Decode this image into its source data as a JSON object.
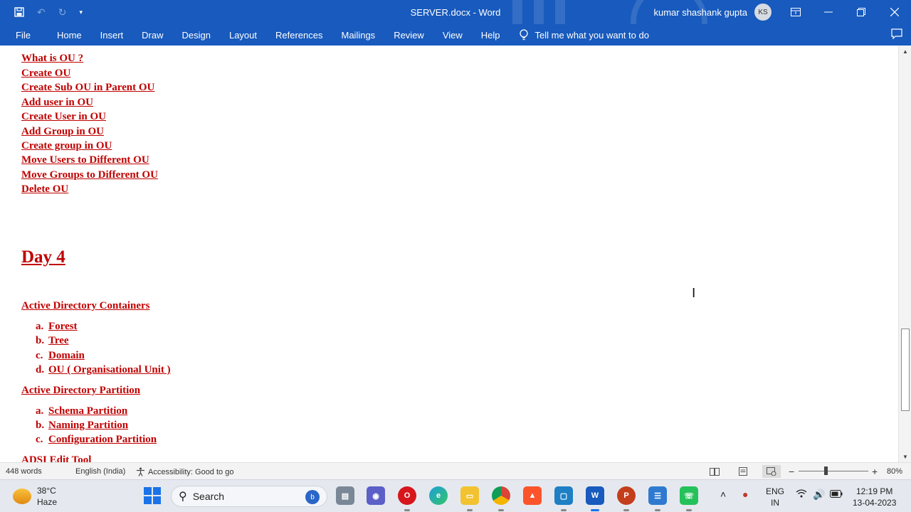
{
  "window": {
    "title": "SERVER.docx",
    "app_name": "Word",
    "user_name": "kumar shashank gupta",
    "user_initials": "KS"
  },
  "ribbon": {
    "tabs": [
      "File",
      "Home",
      "Insert",
      "Draw",
      "Design",
      "Layout",
      "References",
      "Mailings",
      "Review",
      "View",
      "Help"
    ],
    "tell_me": "Tell me what you want to do"
  },
  "document": {
    "ou_links": [
      "What is OU ?",
      "Create OU",
      "Create Sub OU in Parent OU",
      "Add user in OU",
      "Create User in OU",
      "Add Group in OU",
      "Create group in OU",
      "Move Users to Different OU",
      "Move Groups to Different OU",
      "Delete OU"
    ],
    "day_heading": "Day 4",
    "containers": {
      "heading": "Active Directory Containers",
      "items": [
        {
          "marker": "a.",
          "label": "Forest"
        },
        {
          "marker": "b.",
          "label": "Tree"
        },
        {
          "marker": "c.",
          "label": "Domain"
        },
        {
          "marker": "d.",
          "label": "OU ( Organisational Unit )"
        }
      ]
    },
    "partition": {
      "heading": "Active Directory Partition",
      "items": [
        {
          "marker": "a.",
          "label": "Schema Partition"
        },
        {
          "marker": "b.",
          "label": "Naming Partition"
        },
        {
          "marker": "c.",
          "label": "Configuration Partition"
        }
      ]
    },
    "cut_off_heading": "ADSI Edit Tool"
  },
  "status_bar": {
    "word_count": "448 words",
    "language": "English (India)",
    "accessibility": "Accessibility: Good to go",
    "zoom": "80%"
  },
  "taskbar": {
    "temperature": "38°C",
    "weather": "Haze",
    "search_label": "Search",
    "lang_primary": "ENG",
    "lang_secondary": "IN",
    "time": "12:19 PM",
    "date": "13-04-2023"
  },
  "colors": {
    "ribbon_blue": "#185abd",
    "link_red": "#c00000"
  }
}
